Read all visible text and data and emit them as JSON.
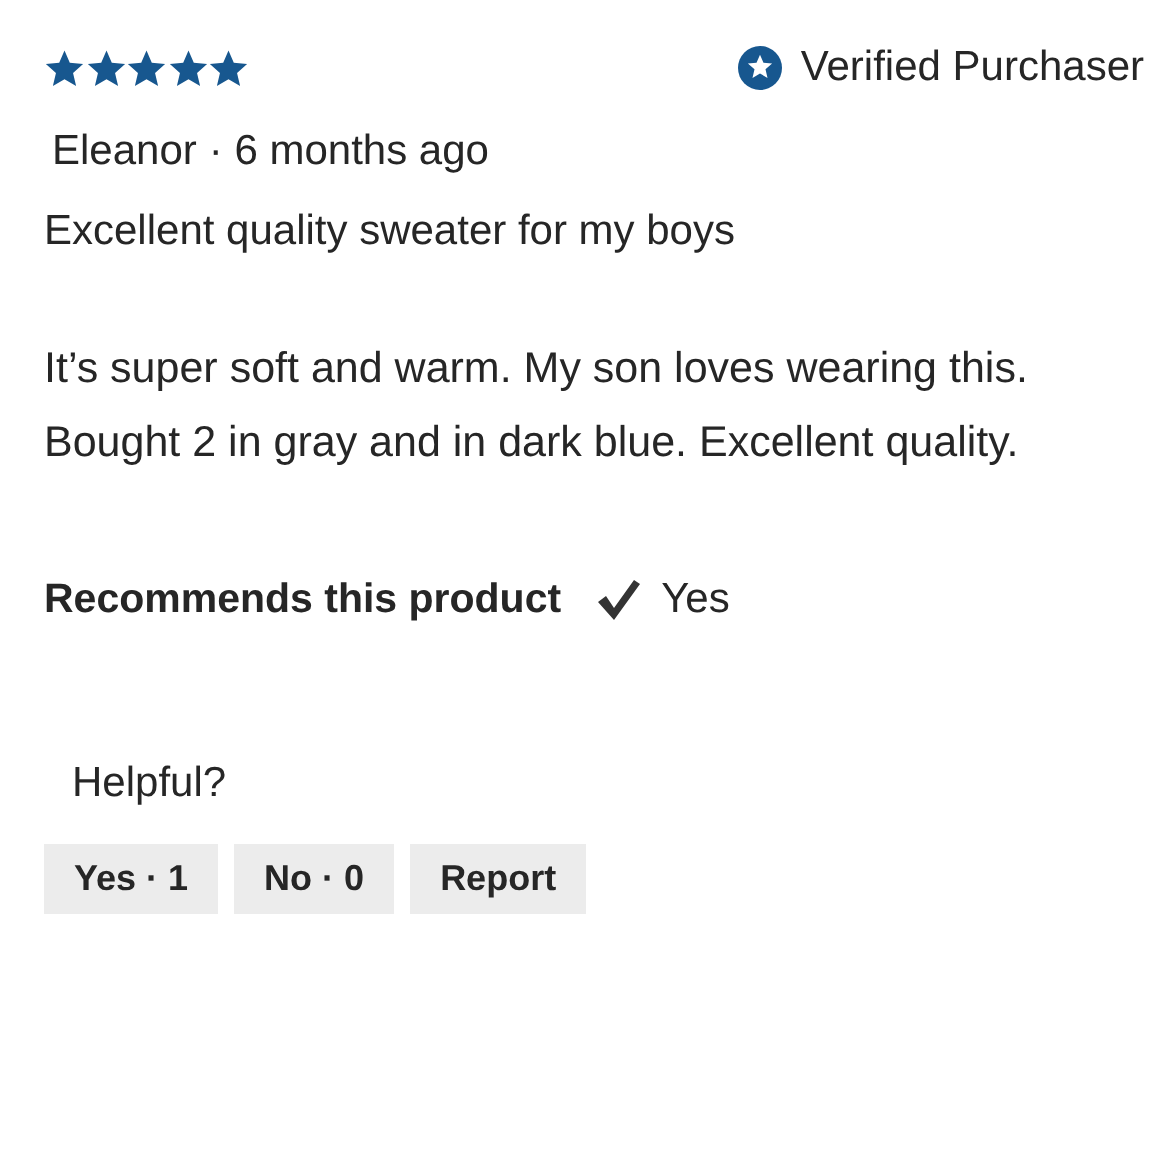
{
  "review": {
    "stars": 5,
    "verified": {
      "label": "Verified Purchaser"
    },
    "author": "Eleanor",
    "time": "· 6 months ago",
    "title": "Excellent quality sweater for my boys",
    "body": "It’s super soft and warm. My son loves wearing this. Bought 2 in gray and in dark blue. Excellent quality.",
    "recommends": {
      "label": "Recommends this product",
      "checked": true,
      "answer": "Yes"
    }
  },
  "helpful": {
    "label": "Helpful?",
    "buttons": [
      "Yes · 1",
      "No · 0",
      "Report"
    ]
  }
}
